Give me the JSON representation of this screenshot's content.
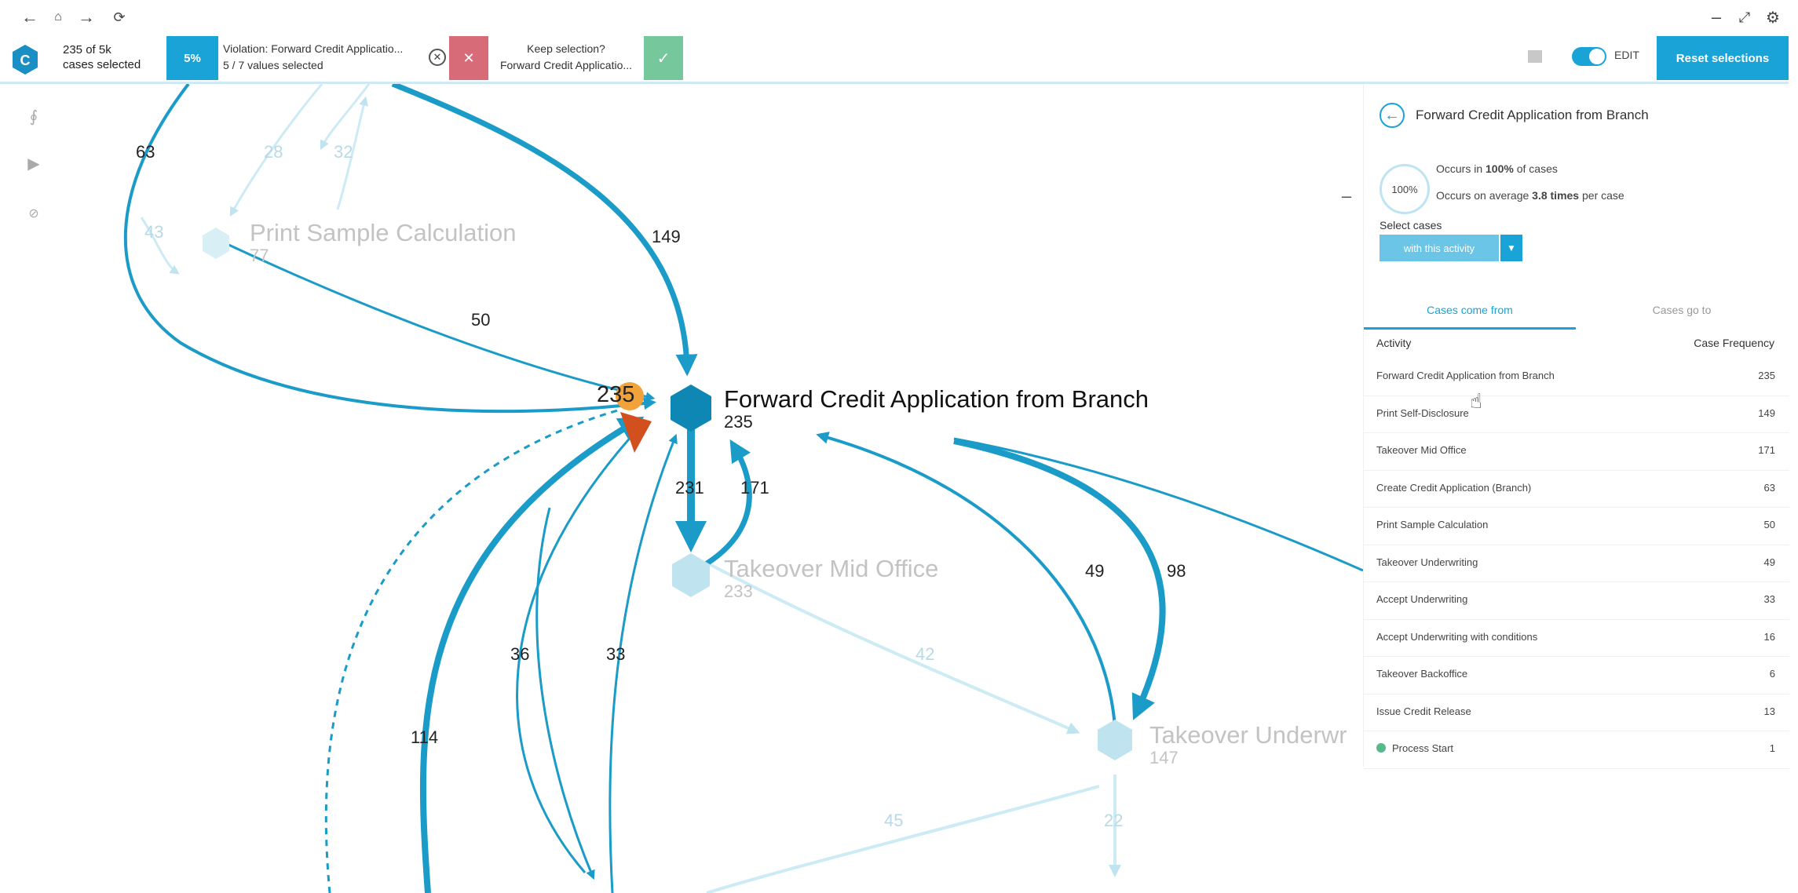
{
  "toolbar": {
    "cases_count_line1": "235 of 5k",
    "cases_count_line2": "cases selected",
    "pct_badge": "5%",
    "violation_title": "Violation: Forward Credit Applicatio...",
    "violation_values": "5 / 7 values selected",
    "keep_title": "Keep selection?",
    "keep_value": "Forward Credit Applicatio...",
    "edit_label": "EDIT",
    "reset_label": "Reset selections"
  },
  "colors": {
    "accent": "#1aa3d6",
    "reject": "#d76b78",
    "accept": "#76c79b"
  },
  "nodes": {
    "forward": {
      "name": "Forward Credit Application from Branch",
      "count": "235"
    },
    "print_sample": {
      "name": "Print Sample Calculation",
      "count": "77"
    },
    "takeover_mid": {
      "name": "Takeover Mid Office",
      "count": "233"
    },
    "takeover_under": {
      "name": "Takeover Underwr",
      "count": "147"
    },
    "start_badge": "235"
  },
  "edges": {
    "e63": "63",
    "e28": "28",
    "e32": "32",
    "e43": "43",
    "e149": "149",
    "e50": "50",
    "e231": "231",
    "e171": "171",
    "e42": "42",
    "e36": "36",
    "e33": "33",
    "e114": "114",
    "e49": "49",
    "e98": "98",
    "e45": "45",
    "e22": "22"
  },
  "panel": {
    "title": "Forward Credit Application from Branch",
    "pct_circle": "100%",
    "occurs_line1_pre": "Occurs in ",
    "occurs_line1_bold": "100%",
    "occurs_line1_post": " of cases",
    "occurs_line2_pre": "Occurs on average ",
    "occurs_line2_bold": "3.8 times",
    "occurs_line2_post": " per case",
    "select_label": "Select cases",
    "select_button": "with this activity",
    "tab_from": "Cases come from",
    "tab_to": "Cases go to",
    "col_activity": "Activity",
    "col_freq": "Case Frequency",
    "rows": [
      {
        "activity": "Forward Credit Application from Branch",
        "freq": "235"
      },
      {
        "activity": "Print Self-Disclosure",
        "freq": "149"
      },
      {
        "activity": "Takeover Mid Office",
        "freq": "171"
      },
      {
        "activity": "Create Credit Application (Branch)",
        "freq": "63"
      },
      {
        "activity": "Print Sample Calculation",
        "freq": "50"
      },
      {
        "activity": "Takeover Underwriting",
        "freq": "49"
      },
      {
        "activity": "Accept Underwriting",
        "freq": "33"
      },
      {
        "activity": "Accept Underwriting with conditions",
        "freq": "16"
      },
      {
        "activity": "Takeover Backoffice",
        "freq": "6"
      },
      {
        "activity": "Issue Credit Release",
        "freq": "13"
      },
      {
        "activity": "Process Start",
        "freq": "1"
      }
    ]
  }
}
